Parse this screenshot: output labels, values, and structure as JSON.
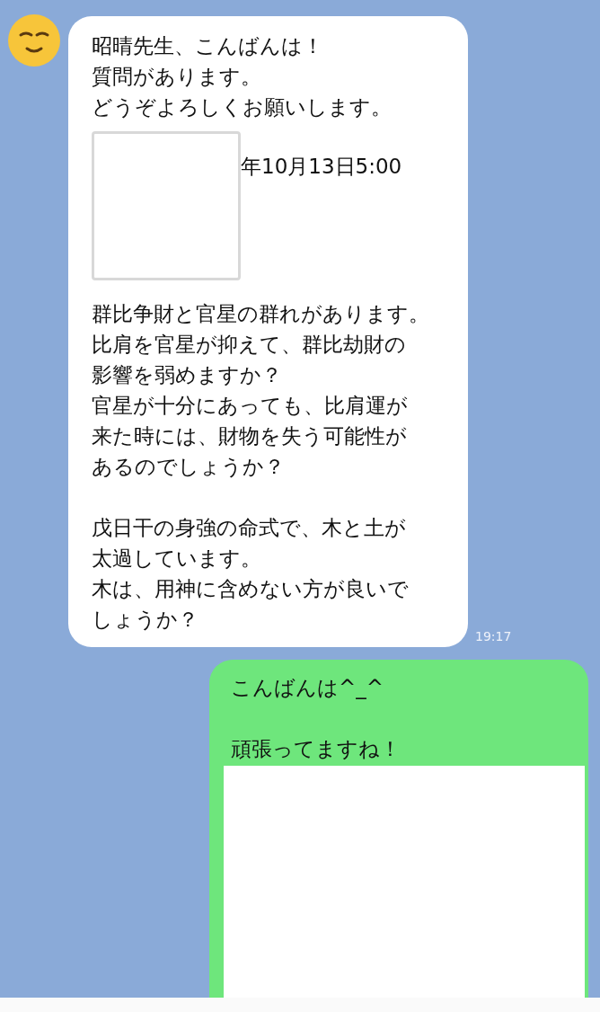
{
  "messages": [
    {
      "kind": "received",
      "time": "19:17",
      "blocks": [
        {
          "kind": "text",
          "lines": [
            "昭晴先生、こんばんは！",
            "質問があります。",
            "どうぞよろしくお願いします。"
          ]
        },
        {
          "kind": "image_row",
          "caption": "年10月13日5:00"
        },
        {
          "kind": "text",
          "lines": [
            "群比争財と官星の群れがあります。",
            "比肩を官星が抑えて、群比劫財の",
            "影響を弱めますか？",
            "官星が十分にあっても、比肩運が",
            "来た時には、財物を失う可能性が",
            "あるのでしょうか？"
          ]
        },
        {
          "kind": "text",
          "lines": [
            "戊日干の身強の命式で、木と土が",
            "太過しています。",
            "木は、用神に含めない方が良いで",
            "しょうか？"
          ]
        }
      ]
    },
    {
      "kind": "sent",
      "blocks": [
        {
          "kind": "text",
          "lines": [
            "こんばんは^_^"
          ]
        },
        {
          "kind": "text",
          "lines": [
            "頑張ってますね！"
          ]
        },
        {
          "kind": "blank"
        }
      ]
    }
  ]
}
